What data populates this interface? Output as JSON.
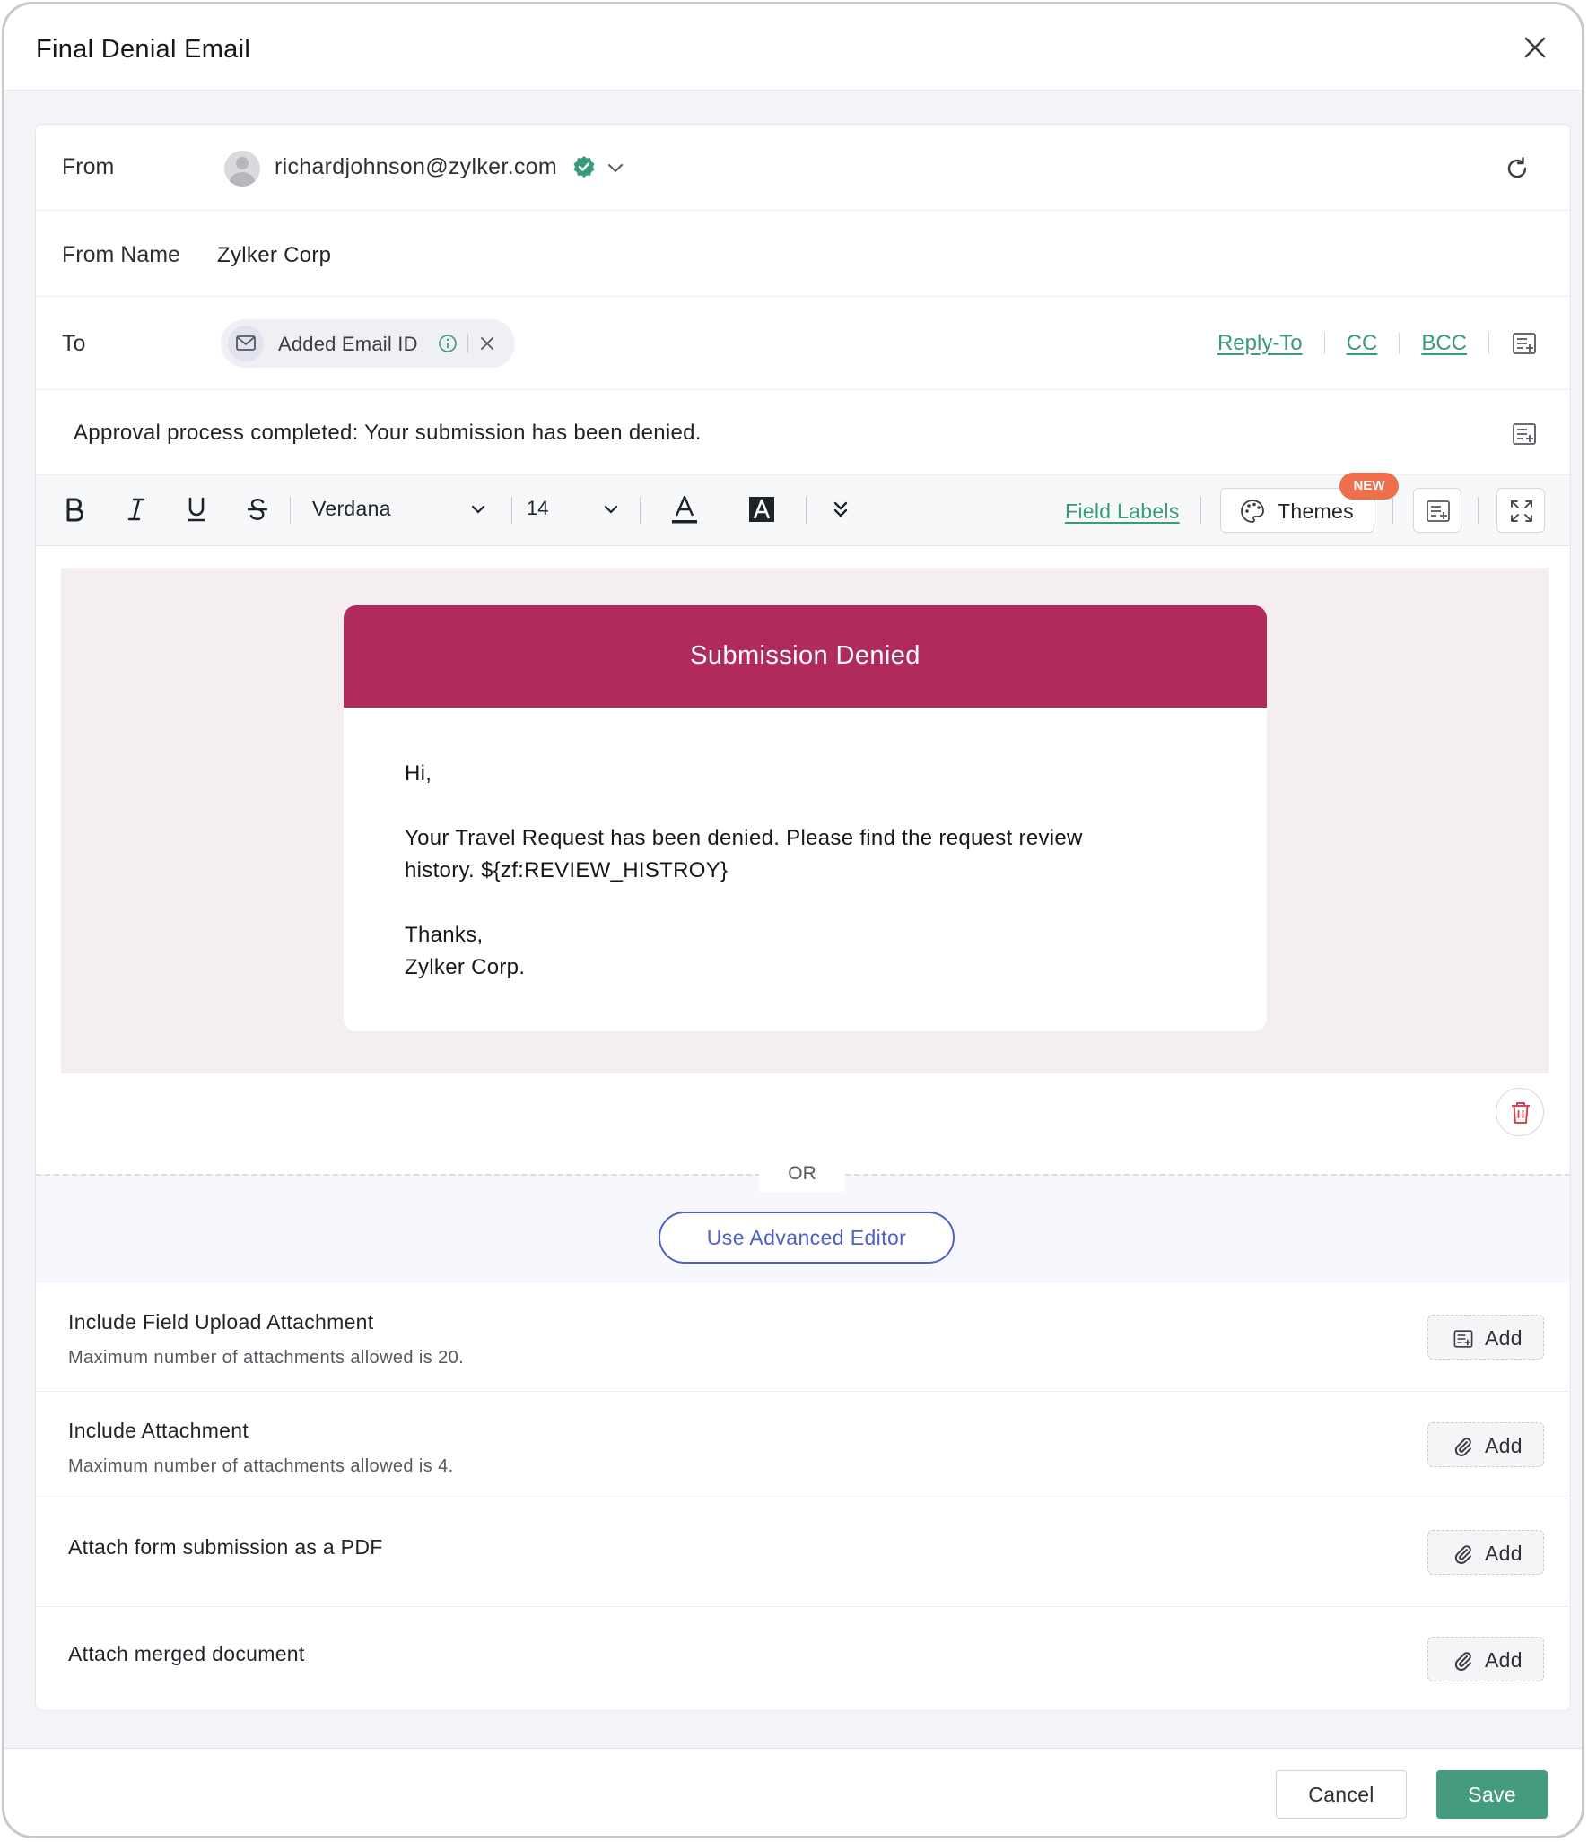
{
  "dialog": {
    "title": "Final Denial Email"
  },
  "from": {
    "label": "From",
    "email": "richardjohnson@zylker.com",
    "verified_icon": "verified-check-icon",
    "verified_color": "#3a9b78"
  },
  "from_name": {
    "label": "From Name",
    "value": "Zylker Corp"
  },
  "to": {
    "label": "To",
    "chip_label": "Added Email ID",
    "links": {
      "reply_to": "Reply-To",
      "cc": "CC",
      "bcc": "BCC"
    }
  },
  "subject": {
    "text": "Approval process completed: Your submission has been denied."
  },
  "toolbar": {
    "font": "Verdana",
    "size": "14",
    "field_labels": "Field Labels",
    "themes": "Themes",
    "new_badge": "NEW"
  },
  "email_body": {
    "header": "Submission Denied",
    "header_color": "#b02b5b",
    "greeting": "Hi,",
    "line1": "Your Travel Request has been denied. Please find the request review",
    "line2": "history. ${zf:REVIEW_HISTROY}",
    "thanks": "Thanks,",
    "signature": "Zylker Corp."
  },
  "editor_switch": {
    "or_label": "OR",
    "advanced_button": "Use Advanced Editor"
  },
  "attachments": [
    {
      "title": "Include Field Upload Attachment",
      "subtitle": "Maximum number of attachments allowed is 20.",
      "button": "Add",
      "icon": "insert-field-icon"
    },
    {
      "title": "Include Attachment",
      "subtitle": "Maximum number of attachments allowed is 4.",
      "button": "Add",
      "icon": "paperclip-icon"
    },
    {
      "title": "Attach form submission as a PDF",
      "subtitle": "",
      "button": "Add",
      "icon": "paperclip-icon"
    },
    {
      "title": "Attach merged document",
      "subtitle": "",
      "button": "Add",
      "icon": "paperclip-icon"
    }
  ],
  "footer": {
    "cancel": "Cancel",
    "save": "Save",
    "save_color": "#449c7c"
  }
}
